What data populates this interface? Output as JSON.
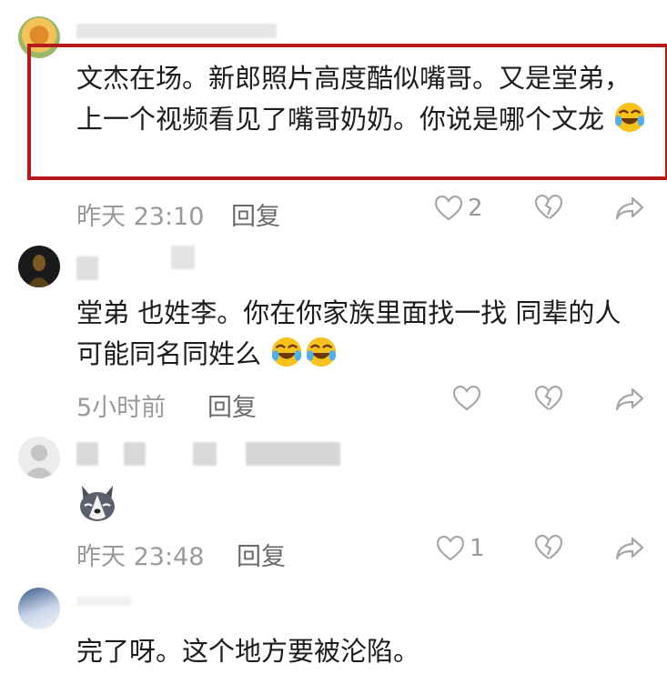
{
  "comments": [
    {
      "text": "文杰在场。新郎照片高度酷似嘴哥。又是堂弟，上一个视频看见了嘴哥奶奶。你说是哪个文龙",
      "time": "昨天 23:10",
      "reply_label": "回复",
      "likes": "2"
    },
    {
      "text": "堂弟 也姓李。你在你家族里面找一找 同辈的人可能同名同姓么",
      "time": "5小时前",
      "reply_label": "回复",
      "likes": ""
    },
    {
      "text": "",
      "time": "昨天 23:48",
      "reply_label": "回复",
      "likes": "1"
    },
    {
      "text": "完了呀。这个地方要被沦陷。",
      "time": "",
      "reply_label": "",
      "likes": ""
    }
  ],
  "colors": {
    "highlight_border": "#b5191c",
    "meta_text": "#9a9a9a",
    "icon": "#a6a6a6"
  },
  "icons": [
    "like-heart-icon",
    "broken-heart-icon",
    "share-arrow-icon",
    "laugh-cry-emoji",
    "husky-emoji"
  ]
}
